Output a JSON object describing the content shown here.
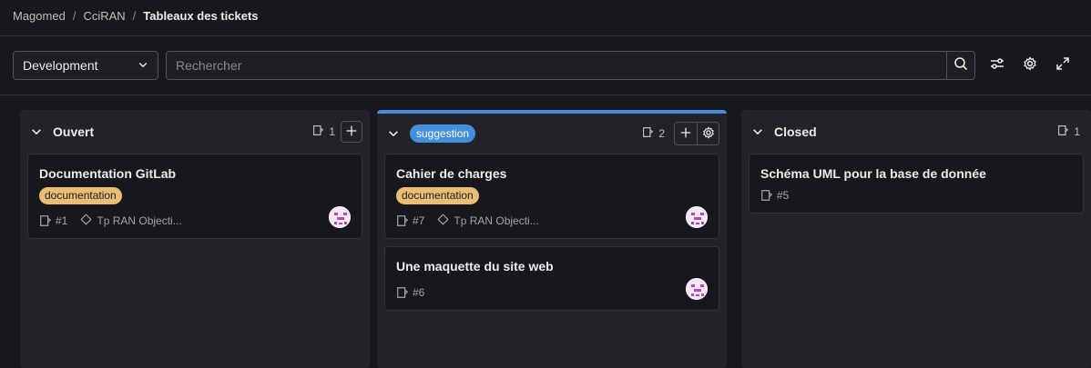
{
  "breadcrumb": {
    "items": [
      "Magomed",
      "CciRAN"
    ],
    "current": "Tableaux des tickets",
    "separator": "/"
  },
  "filters": {
    "board_select": "Development",
    "search_placeholder": "Rechercher"
  },
  "colors": {
    "accent": "#428fdc",
    "doc_label": "#e9be74",
    "background": "#18171d",
    "column": "#232228"
  },
  "lists": [
    {
      "title": "Ouvert",
      "count": "1",
      "cards": [
        {
          "title": "Documentation GitLab",
          "label": "documentation",
          "number": "#1",
          "milestone": "Tp RAN Objecti..."
        }
      ]
    },
    {
      "title": "suggestion",
      "count": "2",
      "cards": [
        {
          "title": "Cahier de charges",
          "label": "documentation",
          "number": "#7",
          "milestone": "Tp RAN Objecti..."
        },
        {
          "title": "Une maquette du site web",
          "number": "#6"
        }
      ]
    },
    {
      "title": "Closed",
      "count": "1",
      "cards": [
        {
          "title": "Schéma UML pour la base de donnée",
          "number": "#5"
        }
      ]
    }
  ]
}
